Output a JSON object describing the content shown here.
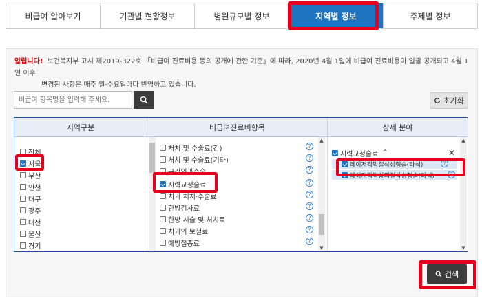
{
  "tabs": [
    {
      "label": "비급여 알아보기"
    },
    {
      "label": "기관별 현황정보"
    },
    {
      "label": "병원규모별 정보"
    },
    {
      "label": "지역별 정보"
    },
    {
      "label": "주제별 정보"
    }
  ],
  "notice": {
    "label": "알립니다!",
    "line1": "보건복지부 고시 제2019-322호 「비급여 진료비용 등의 공개에 관한 기준」에 따라, 2020년 4월 1일에 비급여 진료비용이 일괄 공개되고 4월 1일 이후",
    "line2": "변경된 사항은 매주 월·수요일마다 반영하고 있습니다."
  },
  "search": {
    "placeholder": "비급여 항목명을 입력해 주세요.",
    "reset_label": "초기화",
    "submit_label": "검색"
  },
  "columns": {
    "region_header": "지역구분",
    "items_header": "비급여진료비항목",
    "detail_header": "상세 분야"
  },
  "regions": [
    {
      "label": "전체",
      "checked": false
    },
    {
      "label": "서울",
      "checked": true
    },
    {
      "label": "부산",
      "checked": false
    },
    {
      "label": "인천",
      "checked": false
    },
    {
      "label": "대구",
      "checked": false
    },
    {
      "label": "광주",
      "checked": false
    },
    {
      "label": "대전",
      "checked": false
    },
    {
      "label": "울산",
      "checked": false
    },
    {
      "label": "경기",
      "checked": false
    }
  ],
  "items": [
    {
      "label": "처치 및 수술료(간)",
      "checked": false
    },
    {
      "label": "처치 및 수술료(기타)",
      "checked": false
    },
    {
      "label": "구강외과수술",
      "checked": false
    },
    {
      "label": "시력교정술료",
      "checked": true
    },
    {
      "label": "치과 처치·수술료",
      "checked": false
    },
    {
      "label": "한방검사료",
      "checked": false
    },
    {
      "label": "한방 시술 및 처치료",
      "checked": false
    },
    {
      "label": "치과의 보철료",
      "checked": false
    },
    {
      "label": "예방접종료",
      "checked": false
    }
  ],
  "detail": {
    "group_label": "시력교정술료",
    "rows": [
      {
        "label": "레이저각막절삭성형술(라식)",
        "checked": true
      },
      {
        "label": "레이저각막상피절삭성형술(라섹)",
        "checked": true
      }
    ]
  },
  "icons": {
    "search": "search-icon",
    "reset": "refresh-icon",
    "help": "question-icon",
    "close": "close-icon",
    "collapse": "chevron-up-icon"
  },
  "colors": {
    "accent": "#1e73be",
    "highlight": "#e6001e",
    "alert": "#e00000",
    "dark_button": "#3c3c3c"
  }
}
